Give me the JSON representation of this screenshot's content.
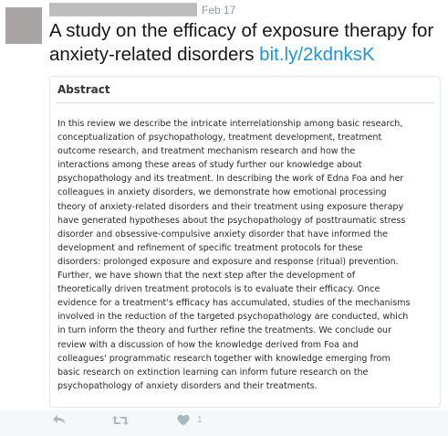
{
  "tweet": {
    "date": "Feb 17",
    "text": "A study on the efficacy of exposure therapy for anxiety-related disorders ",
    "link": "bit.ly/2kdnksK"
  },
  "card": {
    "title": "Abstract",
    "body": "In this review we describe the intricate interrelationship among basic research,\nconceptualization of psychopathology, treatment development, treatment\noutcome research, and treatment mechanism research and how the\ninteractions among these areas of study further our knowledge about\npsychopathology and its treatment. In describing the work of Edna Foa and her\ncolleagues in anxiety disorders, we demonstrate how emotional processing\ntheory of anxiety-related disorders and their treatment using exposure therapy\nhave generated hypotheses about the psychopathology of posttraumatic stress\ndisorder and obsessive-compulsive anxiety disorder that have informed the\ndevelopment and refinement of specific treatment protocols for these\ndisorders: prolonged exposure and exposure and response (ritual) prevention.\nFurther, we have shown that the next step after the development of\ntheoretically driven treatment protocols is to evaluate their efficacy. Once\nevidence for a treatment's efficacy has accumulated, studies of the mechanisms\ninvolved in the reduction of the targeted psychopathology are conducted, which\nin turn inform the theory and further refine the treatments. We conclude our\nreview with a discussion of how the knowledge derived from Foa and\ncolleagues' programmatic research together with knowledge emerging from\nbasic research on extinction learning can inform future research on the\npsychopathology of anxiety disorders and their treatments."
  },
  "actions": {
    "reply_icon": "reply-icon",
    "retweet_icon": "retweet-icon",
    "like_icon": "heart-icon",
    "like_count": "1"
  }
}
